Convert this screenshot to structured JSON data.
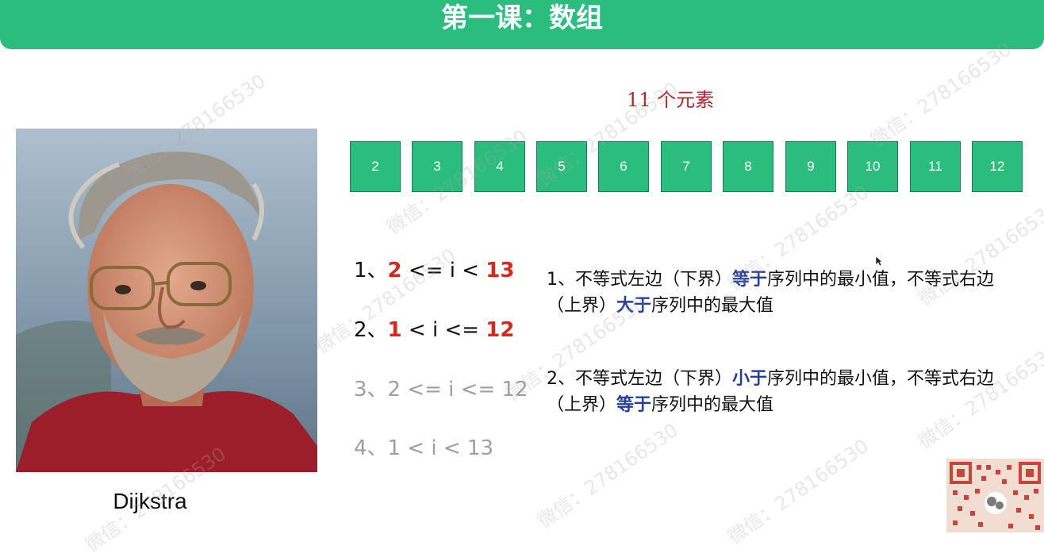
{
  "slide": {
    "title": "第一课：数组"
  },
  "portrait": {
    "caption": "Dijkstra"
  },
  "array": {
    "count_label": "11 个元素",
    "cells": [
      "2",
      "3",
      "4",
      "5",
      "6",
      "7",
      "8",
      "9",
      "10",
      "11",
      "12"
    ]
  },
  "options": [
    {
      "prefix": "1、",
      "lower": "2",
      "mid": " <= i < ",
      "upper": "13"
    },
    {
      "prefix": "2、",
      "lower": "1",
      "mid": " < i <= ",
      "upper": "12"
    },
    {
      "text": "3、2 <= i <= 12"
    },
    {
      "text": "4、1 < i < 13"
    }
  ],
  "explanations": [
    {
      "pre": "1、不等式左边（下界）",
      "em1": "等于",
      "mid": "序列中的最小值，不等式右边（上界）",
      "em2": "大于",
      "post": "序列中的最大值"
    },
    {
      "pre": "2、不等式左边（下界）",
      "em1": "小于",
      "mid": "序列中的最小值，不等式右边（上界）",
      "em2": "等于",
      "post": "序列中的最大值"
    }
  ],
  "watermark": {
    "text": "微信：278166530"
  },
  "colors": {
    "accent_green": "#2bbd7e",
    "highlight_red": "#d5281f",
    "highlight_blue": "#243e99",
    "label_red": "#b0262d"
  }
}
